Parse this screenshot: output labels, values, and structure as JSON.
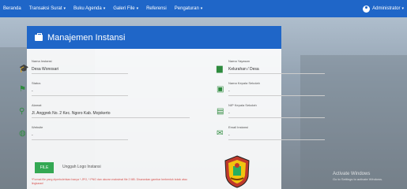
{
  "navbar": {
    "items": [
      {
        "label": "Beranda",
        "dropdown": false
      },
      {
        "label": "Transaksi Surat",
        "dropdown": true
      },
      {
        "label": "Buku Agenda",
        "dropdown": true
      },
      {
        "label": "Galeri File",
        "dropdown": true
      },
      {
        "label": "Referensi",
        "dropdown": false
      },
      {
        "label": "Pengaturan",
        "dropdown": true
      }
    ],
    "user": {
      "label": "Administrator",
      "icon": "user-circle-icon"
    }
  },
  "card": {
    "title": "Manajemen Instansi",
    "fields": {
      "nama_instansi": {
        "label": "Nama Instansi",
        "value": "Desa Wonosari",
        "icon": "graduation-cap-icon"
      },
      "nama_yayasan": {
        "label": "Nama Yayasan",
        "value": "Kelurahan / Desa",
        "icon": "building-icon"
      },
      "status": {
        "label": "Status",
        "value": "-",
        "icon": "flag-icon"
      },
      "nama_kepala": {
        "label": "Nama Kepala Sekolah",
        "value": "-",
        "icon": "contact-card-icon"
      },
      "alamat": {
        "label": "Alamat",
        "value": "Jl. Anggrek No. 2 Kec. Ngoro Kab. Mojokerto",
        "icon": "map-marker-icon"
      },
      "nip_kepala": {
        "label": "NIP Kepala Sekolah",
        "value": "-",
        "icon": "id-badge-icon"
      },
      "website": {
        "label": "Website",
        "value": "-",
        "icon": "globe-icon"
      },
      "email": {
        "label": "Email Instansi",
        "value": "-",
        "icon": "envelope-icon"
      }
    },
    "file_button": "FILE",
    "file_label": "Unggah Logo Instansi",
    "warning": "*Format file yang diperbolehkan hanya *.JPG, *.PNG dan ukuran maksimal file 2 MB. Disarankan gambar berbentuk kotak atau lingkaran!"
  },
  "watermark": {
    "title": "Activate Windows",
    "subtitle": "Go to Settings to activate Windows."
  },
  "colors": {
    "primary": "#1f66c8",
    "green": "#2e8b3e",
    "danger": "#d9534f"
  }
}
